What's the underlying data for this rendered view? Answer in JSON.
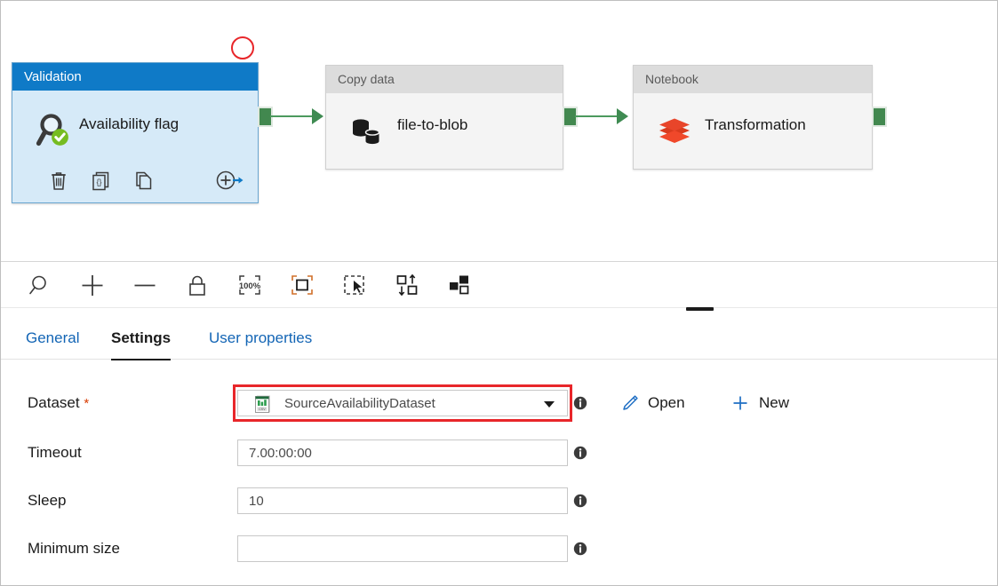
{
  "canvas": {
    "nodes": [
      {
        "type_label": "Validation",
        "name": "Availability flag",
        "icon": "magnifier-check-icon",
        "selected": true,
        "actions": [
          {
            "label": "Delete",
            "icon": "trash-icon"
          },
          {
            "label": "Code",
            "icon": "code-braces-icon"
          },
          {
            "label": "Clone",
            "icon": "copy-pages-icon"
          },
          {
            "label": "Add output",
            "icon": "add-arrow-icon"
          }
        ]
      },
      {
        "type_label": "Copy data",
        "name": "file-to-blob",
        "icon": "database-copy-icon",
        "selected": false
      },
      {
        "type_label": "Notebook",
        "name": "Transformation",
        "icon": "databricks-layers-icon",
        "selected": false
      }
    ],
    "annotation": {
      "shape": "circle",
      "color": "#e8262a"
    },
    "connector_color": "#42884f"
  },
  "toolbar": {
    "buttons": [
      {
        "name": "zoom-search",
        "icon": "magnifier-icon"
      },
      {
        "name": "zoom-in",
        "icon": "plus-icon"
      },
      {
        "name": "zoom-out",
        "icon": "minus-icon"
      },
      {
        "name": "lock",
        "icon": "lock-icon"
      },
      {
        "name": "zoom-100",
        "icon": "zoom-100-percent-icon",
        "label": "100%"
      },
      {
        "name": "zoom-to-fit",
        "icon": "fit-to-screen-icon"
      },
      {
        "name": "select-region",
        "icon": "marquee-select-icon"
      },
      {
        "name": "auto-align",
        "icon": "auto-align-icon"
      },
      {
        "name": "layout",
        "icon": "node-layout-icon"
      }
    ]
  },
  "tabs": [
    {
      "label": "General",
      "active": false
    },
    {
      "label": "Settings",
      "active": true
    },
    {
      "label": "User properties",
      "active": false
    }
  ],
  "settings": {
    "rows": [
      {
        "label": "Dataset",
        "required": true,
        "required_marker": "*",
        "control": "dropdown",
        "value": "SourceAvailabilityDataset",
        "icon": "csv-file-icon",
        "highlighted": true,
        "info": "i",
        "actions": [
          {
            "label": "Open",
            "icon": "pencil-icon"
          },
          {
            "label": "New",
            "icon": "plus-icon"
          }
        ]
      },
      {
        "label": "Timeout",
        "required": false,
        "control": "textbox",
        "value": "7.00:00:00",
        "info": "i"
      },
      {
        "label": "Sleep",
        "required": false,
        "control": "textbox",
        "value": "10",
        "info": "i"
      },
      {
        "label": "Minimum size",
        "required": false,
        "control": "textbox",
        "value": "",
        "info": "i"
      }
    ]
  },
  "colors": {
    "selected_header": "#0f7ac7",
    "selected_body": "#d6eaf8",
    "node_header": "#dcdcdc",
    "node_body": "#f4f4f4",
    "connector": "#42884f",
    "annotation": "#e8262a",
    "link": "#1365b5"
  }
}
